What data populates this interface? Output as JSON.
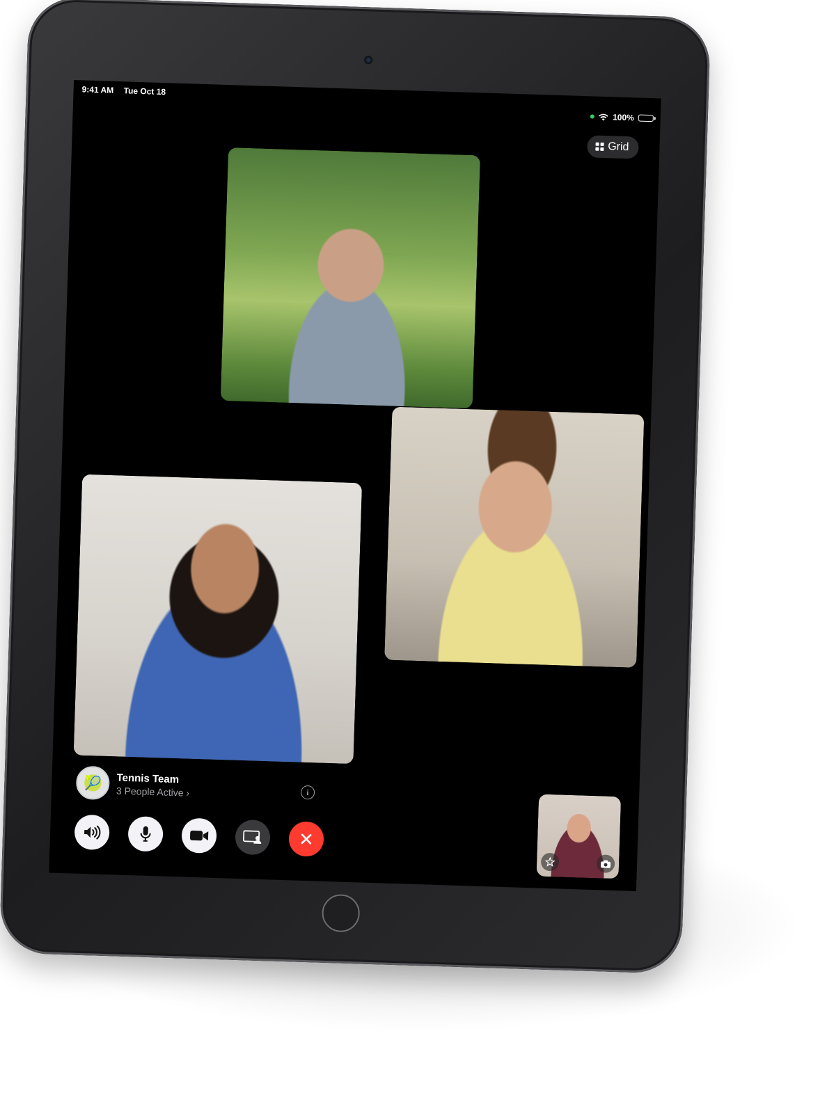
{
  "status_bar": {
    "time": "9:41 AM",
    "date": "Tue Oct 18",
    "battery": "100%"
  },
  "layout_button": {
    "label": "Grid",
    "icon": "grid-icon"
  },
  "participants": [
    {
      "id": "participant-1",
      "description_icon": "video-tile"
    },
    {
      "id": "participant-2",
      "description_icon": "video-tile"
    },
    {
      "id": "participant-3",
      "description_icon": "video-tile"
    }
  ],
  "self_view": {
    "effects_icon": "effects-star-icon",
    "flip_icon": "camera-flip-icon"
  },
  "call_info": {
    "group_name": "Tennis Team",
    "active_text": "3 People Active ›",
    "avatar_glyph": "🎾",
    "info_glyph": "i"
  },
  "controls": [
    {
      "name": "speaker-button",
      "icon": "speaker-icon"
    },
    {
      "name": "mute-button",
      "icon": "microphone-icon"
    },
    {
      "name": "camera-button",
      "icon": "video-camera-icon"
    },
    {
      "name": "shareplay-button",
      "icon": "share-screen-icon"
    },
    {
      "name": "end-call-button",
      "icon": "close-icon"
    }
  ],
  "colors": {
    "end_call": "#ff3b30",
    "camera_indicator": "#30d158",
    "bezel": "#1d1d1f"
  }
}
